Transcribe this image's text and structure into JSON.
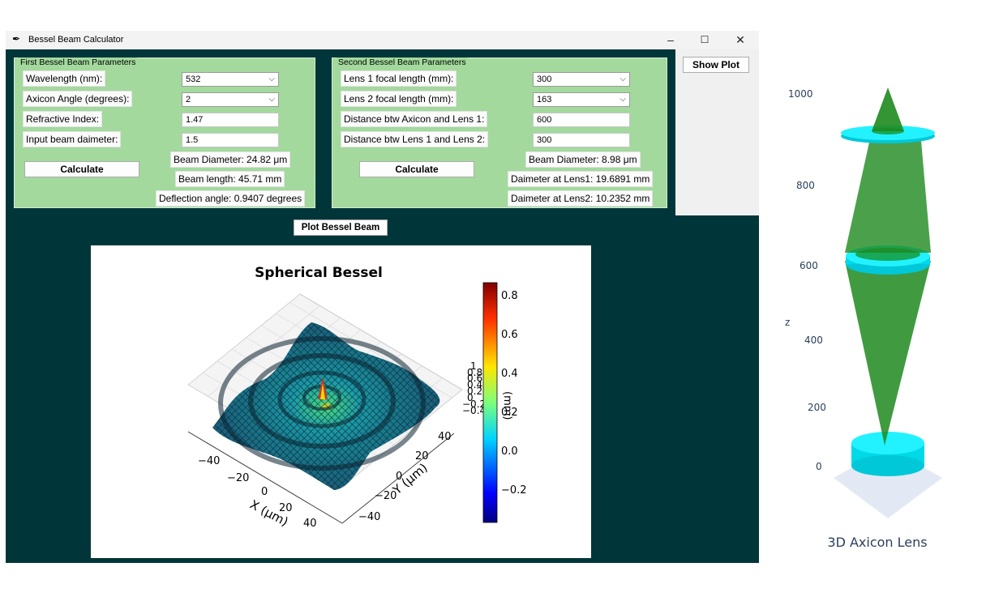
{
  "window": {
    "title": "Bessel Beam Calculator",
    "app_icon": "feather-icon",
    "controls": {
      "minimize": "–",
      "maximize": "☐",
      "close": "✕"
    }
  },
  "frame1": {
    "title": "First Bessel Beam Parameters",
    "wavelength": {
      "label": "Wavelength (nm):",
      "value": "532"
    },
    "axicon_angle": {
      "label": "Axicon Angle (degrees):",
      "value": "2"
    },
    "refractive_index": {
      "label": "Refractive Index:",
      "value": "1.47"
    },
    "input_diameter": {
      "label": "Input beam daimeter:",
      "value": "1.5"
    },
    "calculate_label": "Calculate",
    "results": {
      "beam_diameter": "Beam Diameter: 24.82 μm",
      "beam_length": "Beam length: 45.71 mm",
      "deflection": "Deflection angle: 0.9407 degrees"
    }
  },
  "frame2": {
    "title": "Second Bessel Beam Parameters",
    "lens1_focal": {
      "label": "Lens 1 focal length (mm):",
      "value": "300"
    },
    "lens2_focal": {
      "label": "Lens 2 focal length (mm):",
      "value": "163"
    },
    "dist_axicon_lens1": {
      "label": "Distance btw Axicon and Lens 1:",
      "value": "600"
    },
    "dist_lens1_lens2": {
      "label": "Distance btw Lens 1 and Lens 2:",
      "value": "300"
    },
    "calculate_label": "Calculate",
    "results": {
      "beam_diameter": "Beam Diameter: 8.98 μm",
      "diameter_lens1": "Daimeter at Lens1: 19.6891 mm",
      "diameter_lens2": "Daimeter at Lens2: 10.2352 mm"
    }
  },
  "show_plot_label": "Show Plot",
  "plot_bessel_label": "Plot Bessel Beam",
  "bessel_plot": {
    "title": "Spherical Bessel",
    "xlabel": "X (μm)",
    "ylabel": "Y (μm)",
    "zlabel": "(mm)",
    "x_ticks": [
      "−40",
      "−20",
      "0",
      "20",
      "40"
    ],
    "y_ticks": [
      "40",
      "20",
      "0",
      "−20",
      "−40"
    ],
    "z_ticks": [
      "1",
      "0.8",
      "0.6",
      "0.4",
      "0.2",
      "0",
      "−0.2",
      "−0.4"
    ],
    "colorbar_ticks": [
      "0.8",
      "0.6",
      "0.4",
      "0.2",
      "0.0",
      "−0.2"
    ]
  },
  "axicon_plot": {
    "title": "3D Axicon Lens",
    "zlabel": "z",
    "z_ticks": [
      "1000",
      "800",
      "600",
      "400",
      "200",
      "0"
    ]
  },
  "chart_data": [
    {
      "type": "surface",
      "title": "Spherical Bessel",
      "xlabel": "X (μm)",
      "ylabel": "Y (μm)",
      "x_range": [
        -50,
        50
      ],
      "y_range": [
        -50,
        50
      ],
      "colorbar_range": [
        -0.4,
        0.85
      ],
      "colormap": "jet"
    },
    {
      "type": "3d",
      "title": "3D Axicon Lens",
      "zlabel": "z",
      "z_range": [
        0,
        1000
      ],
      "lens_z": [
        0,
        600,
        900
      ]
    }
  ]
}
